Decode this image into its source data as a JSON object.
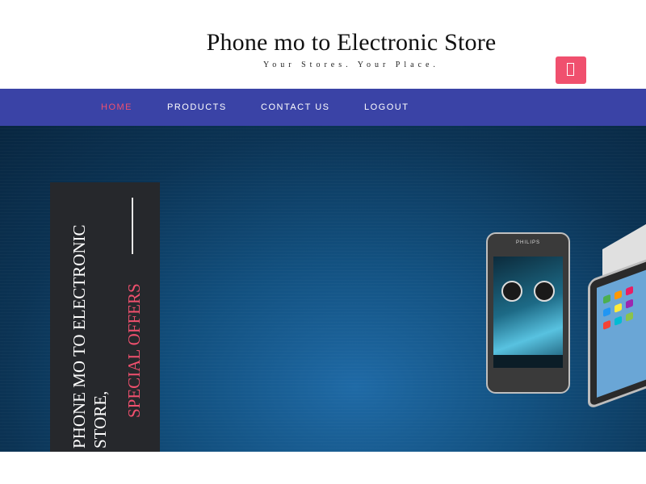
{
  "header": {
    "title": "Phone mo to Electronic Store",
    "tagline": "Your Stores. Your Place.",
    "cart_icon": "cart-icon"
  },
  "nav": {
    "items": [
      {
        "label": "HOME",
        "active": true
      },
      {
        "label": "PRODUCTS",
        "active": false
      },
      {
        "label": "CONTACT US",
        "active": false
      },
      {
        "label": "LOGOUT",
        "active": false
      }
    ]
  },
  "hero": {
    "banner_line1": "PHONE MO TO ELECTRONIC",
    "banner_line2": "STORE,",
    "banner_accent": "SPECIAL OFFERS",
    "phone_brand": "PHILIPS"
  },
  "colors": {
    "accent": "#f0506e",
    "nav_bg": "#3a43a6",
    "banner_bg": "#26282c"
  }
}
